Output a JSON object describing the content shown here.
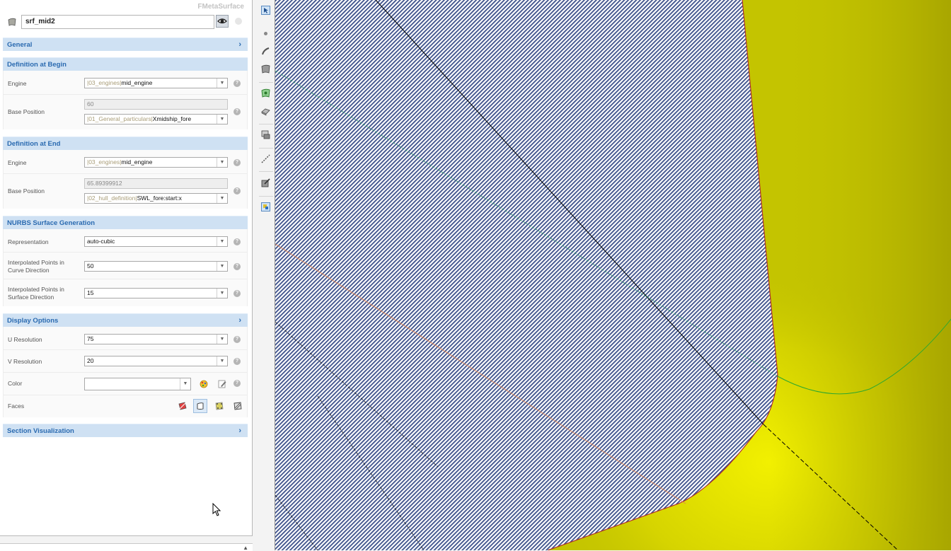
{
  "panel": {
    "title": "FMetaSurface",
    "name_value": "srf_mid2",
    "object_icon": "surface-icon",
    "visibility_icon": "eye-icon"
  },
  "sections": {
    "general": {
      "title": "General"
    },
    "begin": {
      "title": "Definition at Begin",
      "engine": {
        "label": "Engine",
        "prefix": "|03_engines|",
        "value": "mid_engine"
      },
      "base_position": {
        "label": "Base Position",
        "numeric": "60",
        "prefix": "|01_General_particulars|",
        "value": "Xmidship_fore"
      }
    },
    "end": {
      "title": "Definition at End",
      "engine": {
        "label": "Engine",
        "prefix": "|03_engines|",
        "value": "mid_engine"
      },
      "base_position": {
        "label": "Base Position",
        "numeric": "65.89399912",
        "prefix": "|02_hull_definition|",
        "value": "SWL_fore:start:x"
      }
    },
    "nurbs": {
      "title": "NURBS Surface Generation",
      "representation": {
        "label": "Representation",
        "value": "auto-cubic"
      },
      "curve_points": {
        "label_line1": "Interpolated Points in",
        "label_line2": "Curve Direction",
        "value": "50"
      },
      "surface_points": {
        "label_line1": "Interpolated Points in",
        "label_line2": "Surface Direction",
        "value": "15"
      }
    },
    "display": {
      "title": "Display Options",
      "u_resolution": {
        "label": "U Resolution",
        "value": "75"
      },
      "v_resolution": {
        "label": "V Resolution",
        "value": "20"
      },
      "color": {
        "label": "Color",
        "value": ""
      },
      "faces": {
        "label": "Faces"
      }
    },
    "section_vis": {
      "title": "Section Visualization"
    }
  },
  "help_glyph": "?",
  "chevron_glyph": "›",
  "dropdown_glyph": "▼",
  "scroll_up_glyph": "▲",
  "colors": {
    "section_header_bg": "#cfe1f3",
    "section_header_text": "#2a6ab0",
    "surface_yellow": "#c4c400",
    "hatch_blue": "#3b4f8a"
  },
  "toolbar_icons": [
    "select-icon",
    "point-icon",
    "curve-icon",
    "surface-icon",
    "metasurface-icon",
    "solid-icon",
    "section-icon",
    "dimension-icon",
    "render-icon",
    "view-icon"
  ]
}
